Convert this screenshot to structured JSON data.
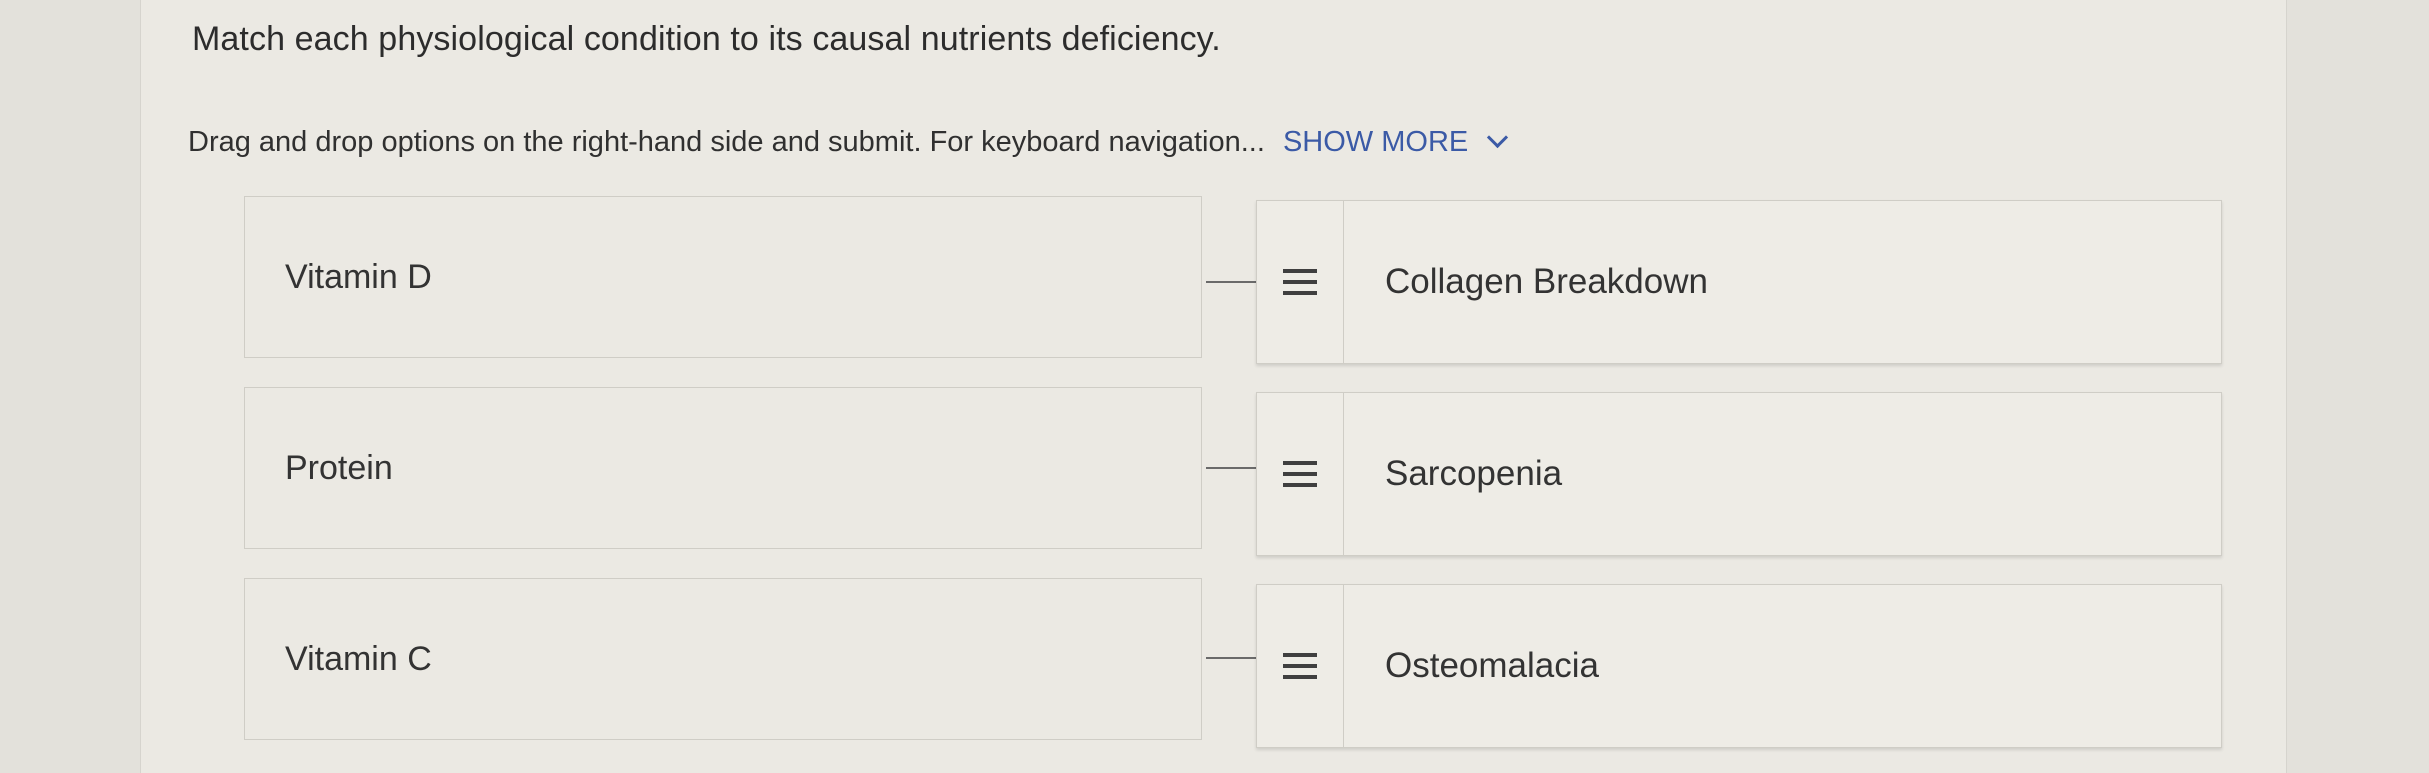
{
  "question": {
    "title": "Match each physiological condition to its causal nutrients deficiency.",
    "instructions": "Drag and drop options on the right-hand side and submit. For keyboard navigation...",
    "show_more_label": "SHOW MORE"
  },
  "left_items": [
    {
      "label": "Vitamin D"
    },
    {
      "label": "Protein"
    },
    {
      "label": "Vitamin C"
    }
  ],
  "right_items": [
    {
      "label": "Collagen Breakdown",
      "handle_icon": "drag-handle-icon"
    },
    {
      "label": "Sarcopenia",
      "handle_icon": "drag-handle-icon"
    },
    {
      "label": "Osteomalacia",
      "handle_icon": "drag-handle-icon"
    }
  ],
  "colors": {
    "link": "#3b5aa6",
    "text": "#333333",
    "background": "#ebe9e3"
  }
}
